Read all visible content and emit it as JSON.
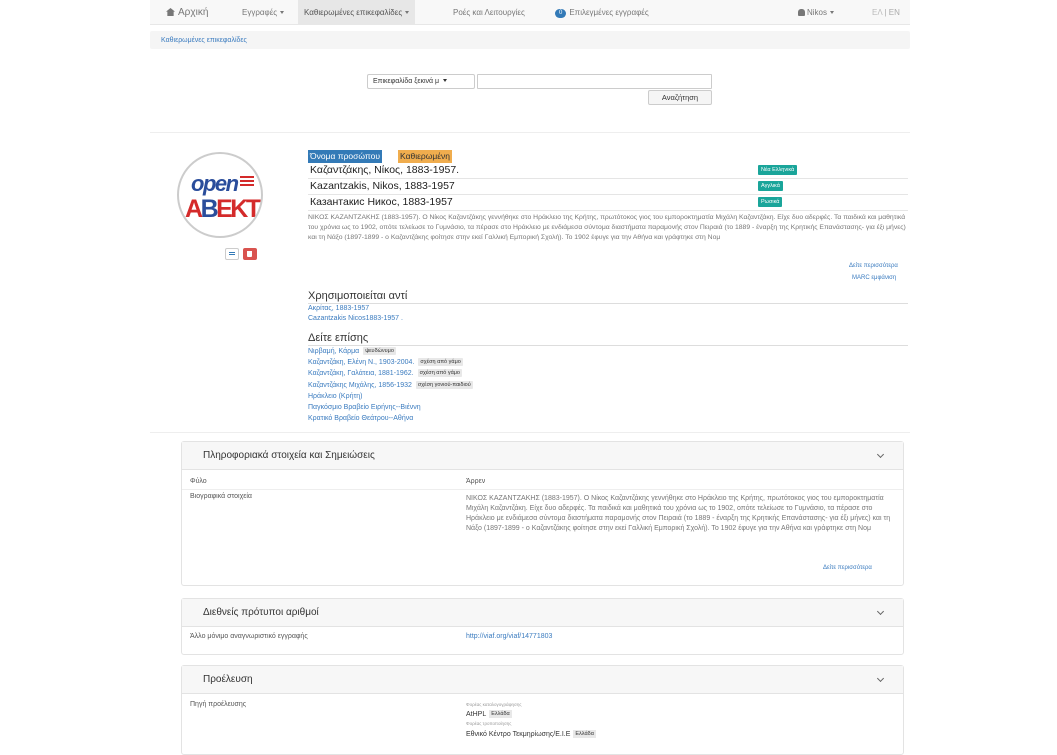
{
  "nav": {
    "home": "Αρχική",
    "records": "Εγγραφές",
    "headings": "Καθιερωμένες επικεφαλίδες",
    "flows": "Ροές και Λειτουργίες",
    "selected_count": "0",
    "selected": "Επιλεγμένες εγγραφές",
    "user": "Nikos",
    "lang_el": "ΕΛ",
    "lang_sep": " | ",
    "lang_en": "EN"
  },
  "breadcrumb": {
    "current": "Καθιερωμένες επικεφαλίδες"
  },
  "search": {
    "select_value": "Επικεφαλίδα ξεκινά μ",
    "input_value": "",
    "button": "Αναζήτηση"
  },
  "record": {
    "type_label": "Όνομα προσώπου",
    "status_label": "Καθιερωμένη",
    "headings": [
      {
        "text": "Καζαντζάκης, Νίκος, 1883-1957.",
        "lang": "Νέα Ελληνικά"
      },
      {
        "text": "Kazantzakis, Nikos, 1883-1957",
        "lang": "Αγγλικά"
      },
      {
        "text": "Казантакис Никос, 1883-1957",
        "lang": "Ρωσικά"
      }
    ],
    "bio": "ΝΙΚΟΣ ΚΑΖΑΝΤΖΑΚΗΣ (1883-1957). Ο Νίκος Καζαντζάκης γεννήθηκε στο Ηράκλειο της Κρήτης, πρωτότοκος γιος του εμποροκτηματία Μιχάλη Καζαντζάκη. Είχε δυο αδερφές. Τα παιδικά και μαθητικά του χρόνια ως το 1902, οπότε τελείωσε το Γυμνάσιο, τα πέρασε στο Ηράκλειο με ενδιάμεσα σύντομα διαστήματα παραμονής στον Πειραιά (το 1889 - έναρξη της Κρητικής Επανάστασης- για έξι μήνες) και τη Νάξο (1897-1899 - ο Καζαντζάκης φοίτησε στην εκεί Γαλλική Εμπορική Σχολή). Το 1902 έφυγε για την Αθήνα και γράφτηκε στη Νομ",
    "see_more": "Δείτε περισσότερα",
    "marc": "MARC εμφάνιση",
    "used_for_title": "Χρησιμοποιείται αντί",
    "used_for": [
      "Ακρίτας, 1883-1957",
      "Cazantzakis Nicos1883-1957 ."
    ],
    "see_also_title": "Δείτε επίσης",
    "see_also": [
      {
        "text": "Νιρβαμή, Κάρμα",
        "tag": "ψευδώνυμο"
      },
      {
        "text": "Καζαντζάκη, Ελένη Ν., 1903-2004.",
        "tag": "σχέση από γάμο"
      },
      {
        "text": "Καζαντζάκη, Γαλάτεια, 1881-1962.",
        "tag": "σχέση από γάμο"
      },
      {
        "text": "Καζαντζάκης Μιχάλης, 1856-1932",
        "tag": "σχέση γονιού-παιδιού"
      },
      {
        "text": "Ηράκλειο (Κρήτη)",
        "tag": ""
      },
      {
        "text": "Παγκόσμιο Βραβείο Ειρήνης--Βιέννη",
        "tag": ""
      },
      {
        "text": "Κρατικό Βραβείο Θεάτρου--Αθήνα",
        "tag": ""
      }
    ]
  },
  "panel_info": {
    "title": "Πληροφοριακά στοιχεία και Σημειώσεις",
    "gender_label": "Φύλο",
    "gender_value": "Άρρεν",
    "bio_label": "Βιογραφικά στοιχεία",
    "bio": "ΝΙΚΟΣ ΚΑΖΑΝΤΖΑΚΗΣ (1883-1957). Ο Νίκος Καζαντζάκης γεννήθηκε στο Ηράκλειο της Κρήτης, πρωτότοκος γιος του εμποροκτηματία Μιχάλη Καζαντζάκη. Είχε δυο αδερφές. Τα παιδικά και μαθητικά του χρόνια ως το 1902, οπότε τελείωσε το Γυμνάσιο, τα πέρασε στο Ηράκλειο με ενδιάμεσα σύντομα διαστήματα παραμονής στον Πειραιά (το 1889 - έναρξη της Κρητικής Επανάστασης- για έξι μήνες) και τη Νάξο (1897-1899 - ο Καζαντζάκης φοίτησε στην εκεί Γαλλική Εμπορική Σχολή). Το 1902 έφυγε για την Αθήνα και γράφτηκε στη Νομ",
    "see_more": "Δείτε περισσότερα"
  },
  "panel_intl": {
    "title": "Διεθνείς πρότυποι αριθμοί",
    "label": "Άλλο μόνιμο αναγνωριστικό εγγραφής",
    "value": "http://viaf.org/viaf/14771803"
  },
  "panel_prov": {
    "title": "Προέλευση",
    "label": "Πηγή προέλευσης",
    "cat_label": "Φορέας καταλογογράφησης",
    "cat_value": "AtHPL",
    "cat_country": "Ελλάδα",
    "mod_label": "Φορέας τροποποίησης",
    "mod_value": "Εθνικό Κέντρο Τεκμηρίωσης/Ε.Ι.Ε",
    "mod_country": "Ελλάδα"
  }
}
